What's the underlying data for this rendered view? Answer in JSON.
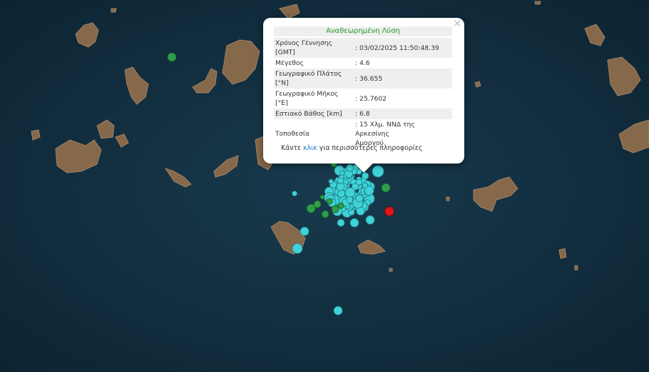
{
  "popup": {
    "title": "Αναθεωρημένη Λύση",
    "rows": [
      {
        "label_1": "Χρόνος Γέννησης",
        "label_2": "[GMT]",
        "value": ": 03/02/2025 11:50:48.39"
      },
      {
        "label_1": "Μέγεθος",
        "label_2": "",
        "value": ": 4.6"
      },
      {
        "label_1": "Γεωγραφικό Πλάτος",
        "label_2": "[°N]",
        "value": ": 36.655"
      },
      {
        "label_1": "Γεωγραφικό Μήκος",
        "label_2": "[°E]",
        "value": ": 25.7602"
      },
      {
        "label_1": "Εστιακό Βάθος [km]",
        "label_2": "",
        "value": ": 6.8"
      },
      {
        "label_1": "Τοποθεσία",
        "label_2": "",
        "value_1": ": 15 Χλμ. ΝΝΔ της Αρκεσίνης",
        "value_2": "Αμοργού"
      }
    ],
    "more_prefix": "Κάντε ",
    "more_link": "κλικ",
    "more_suffix": " για περισσότερες πληροφορίες",
    "close_glyph": "×"
  },
  "colors": {
    "sea": "#0f2a3b",
    "land": "#8a6a4c",
    "recent_marker": "#3fd3d8",
    "older_marker": "#2e9e48",
    "selected_marker": "#e0141b"
  }
}
